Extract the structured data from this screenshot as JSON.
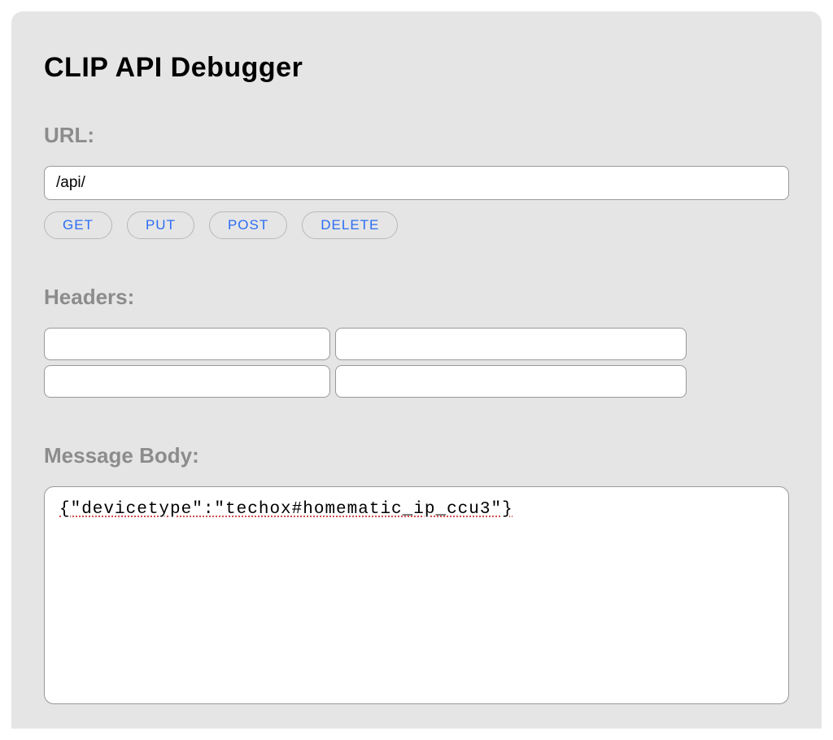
{
  "title": "CLIP API Debugger",
  "url_section": {
    "label": "URL:",
    "value": "/api/"
  },
  "methods": {
    "get": "GET",
    "put": "PUT",
    "post": "POST",
    "delete": "DELETE"
  },
  "headers_section": {
    "label": "Headers:",
    "rows": [
      {
        "key": "",
        "value": ""
      },
      {
        "key": "",
        "value": ""
      }
    ]
  },
  "body_section": {
    "label": "Message Body:",
    "value": "{\"devicetype\":\"techox#homematic_ip_ccu3\"}"
  }
}
